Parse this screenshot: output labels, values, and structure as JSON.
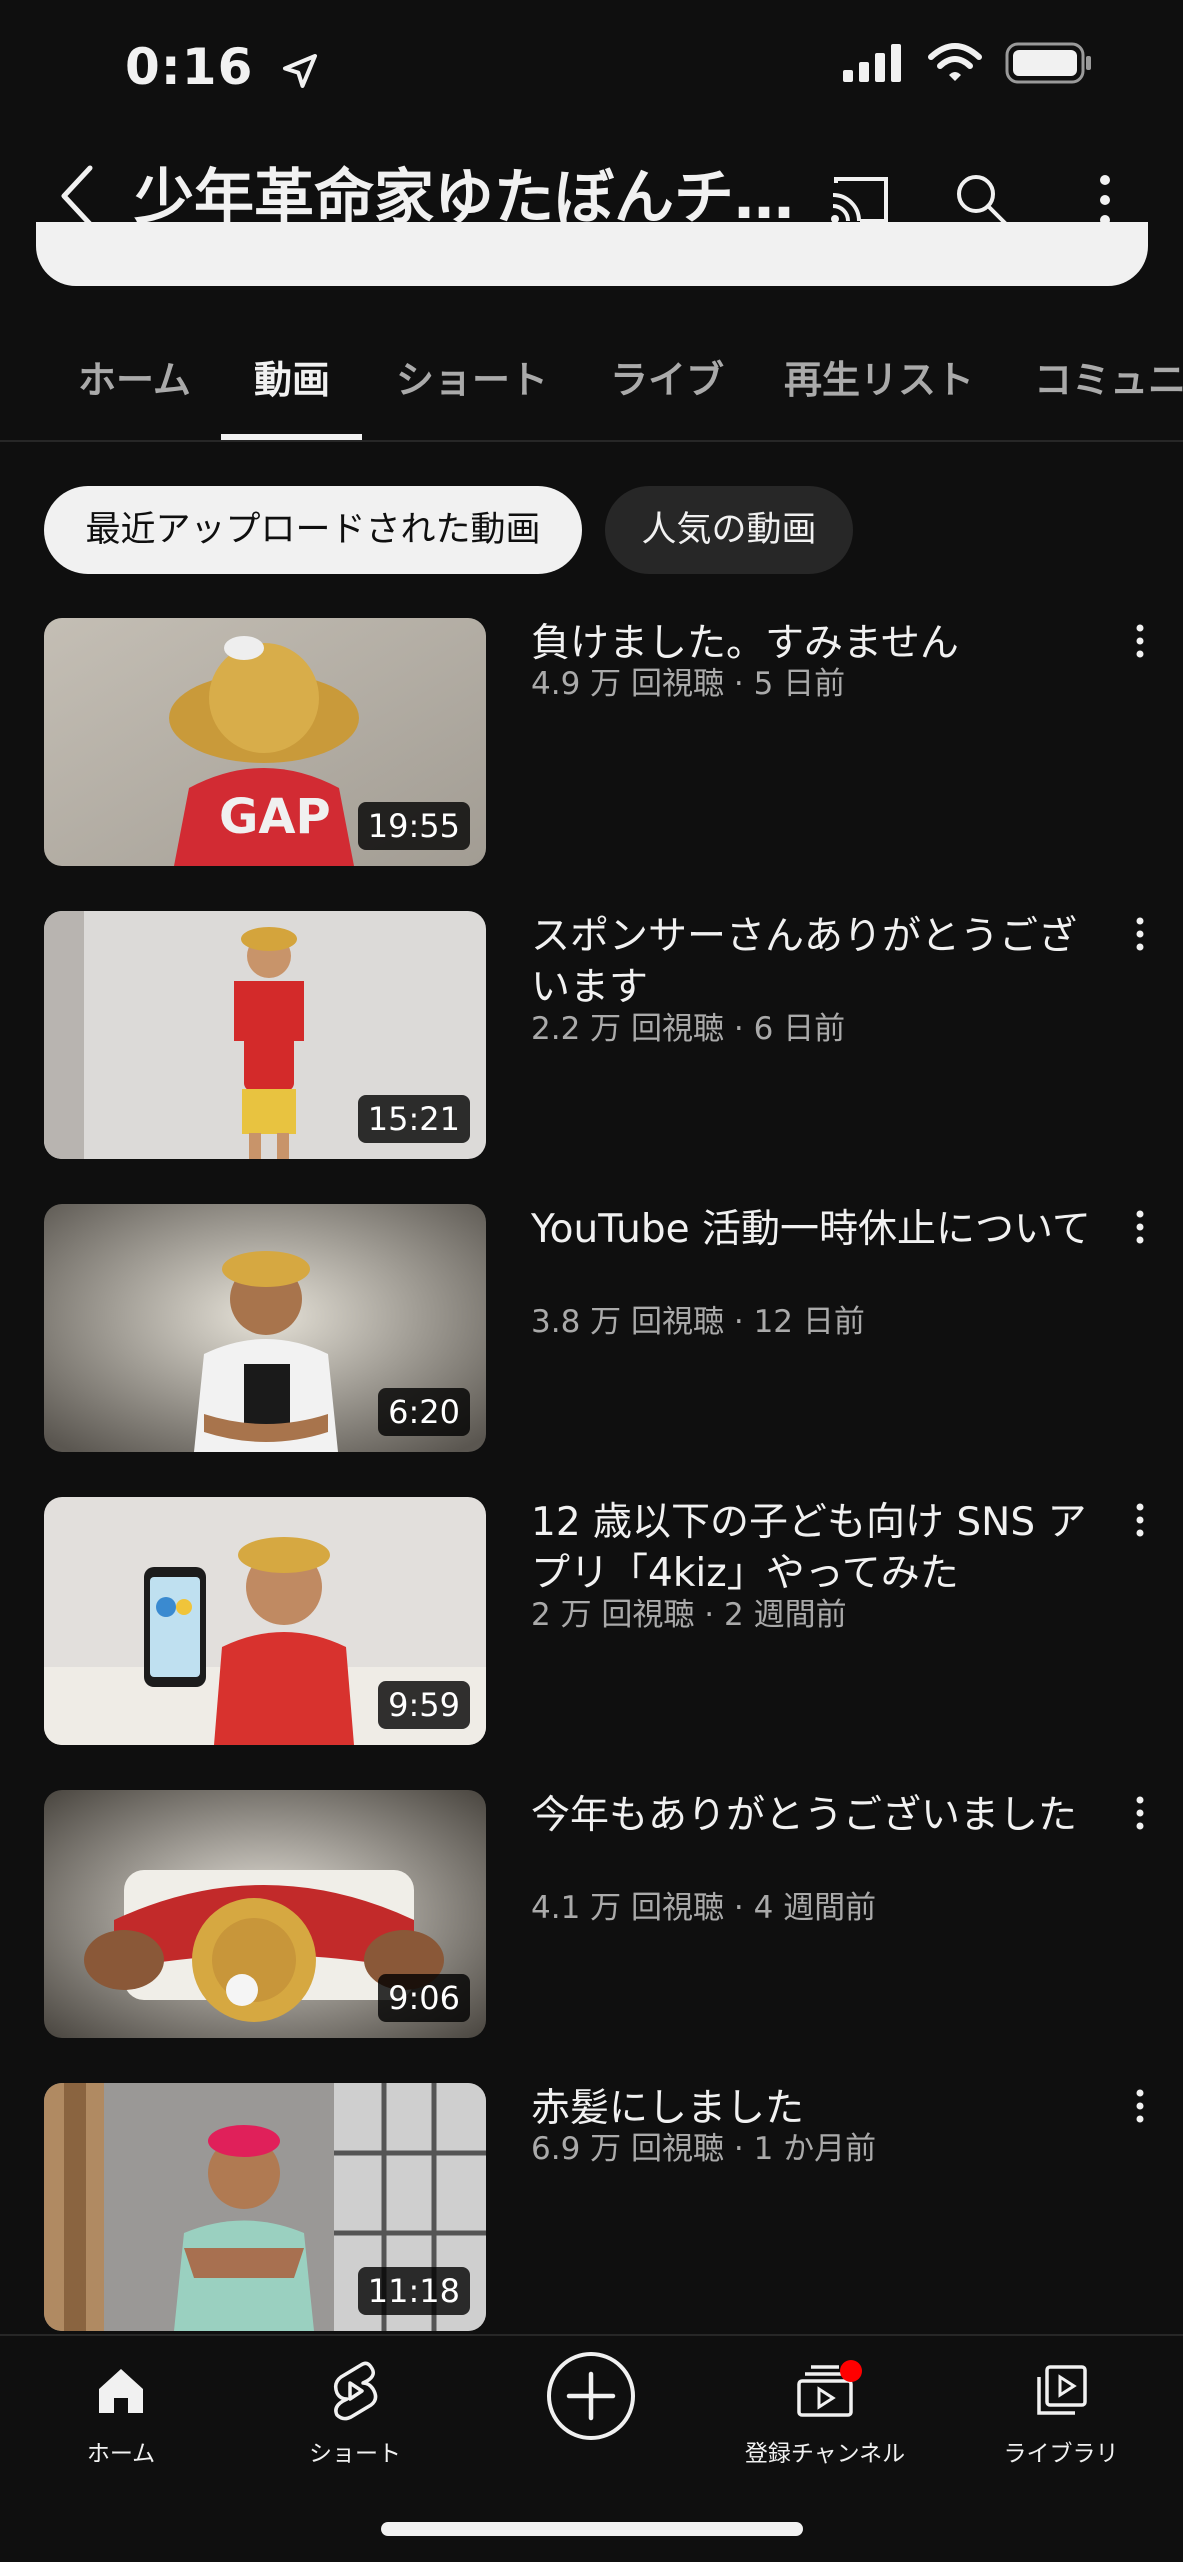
{
  "status_bar": {
    "time": "0:16"
  },
  "header": {
    "channel_title": "少年革命家ゆたぼんチ…"
  },
  "tabs": [
    {
      "label": "ホーム"
    },
    {
      "label": "動画"
    },
    {
      "label": "ショート"
    },
    {
      "label": "ライブ"
    },
    {
      "label": "再生リスト"
    },
    {
      "label": "コミュニ"
    }
  ],
  "active_tab": "動画",
  "filters": [
    {
      "label": "最近アップロードされた動画",
      "selected": true
    },
    {
      "label": "人気の動画",
      "selected": false
    }
  ],
  "videos": [
    {
      "title": "負けました。すみません",
      "views": "4.9 万 回視聴",
      "age": "5 日前",
      "meta": "4.9 万 回視聴 · 5 日前",
      "duration": "19:55"
    },
    {
      "title": "スポンサーさんありがとうございます",
      "views": "2.2 万 回視聴",
      "age": "6 日前",
      "meta": "2.2 万 回視聴 · 6 日前",
      "duration": "15:21"
    },
    {
      "title": "YouTube 活動一時休止について",
      "views": "3.8 万 回視聴",
      "age": "12 日前",
      "meta": "3.8 万 回視聴 · 12 日前",
      "duration": "6:20"
    },
    {
      "title": "12 歳以下の子ども向け SNS アプリ「4kiz」やってみた",
      "views": "2 万 回視聴",
      "age": "2 週間前",
      "meta": "2 万 回視聴 · 2 週間前",
      "duration": "9:59"
    },
    {
      "title": "今年もありがとうございました",
      "views": "4.1 万 回視聴",
      "age": "4 週間前",
      "meta": "4.1 万 回視聴 · 4 週間前",
      "duration": "9:06"
    },
    {
      "title": "赤髪にしました",
      "views": "6.9 万 回視聴",
      "age": "1 か月前",
      "meta": "6.9 万 回視聴 · 1 か月前",
      "duration": "11:18"
    }
  ],
  "bottom_nav": [
    {
      "label": "ホーム",
      "icon": "home-icon"
    },
    {
      "label": "ショート",
      "icon": "shorts-icon"
    },
    {
      "label": "",
      "icon": "create-icon"
    },
    {
      "label": "登録チャンネル",
      "icon": "subscriptions-icon"
    },
    {
      "label": "ライブラリ",
      "icon": "library-icon"
    }
  ],
  "colors": {
    "background": "#0f0f0f",
    "text": "#f1f1f1",
    "secondary_text": "#aaaaaa",
    "notification": "#ff0000"
  }
}
